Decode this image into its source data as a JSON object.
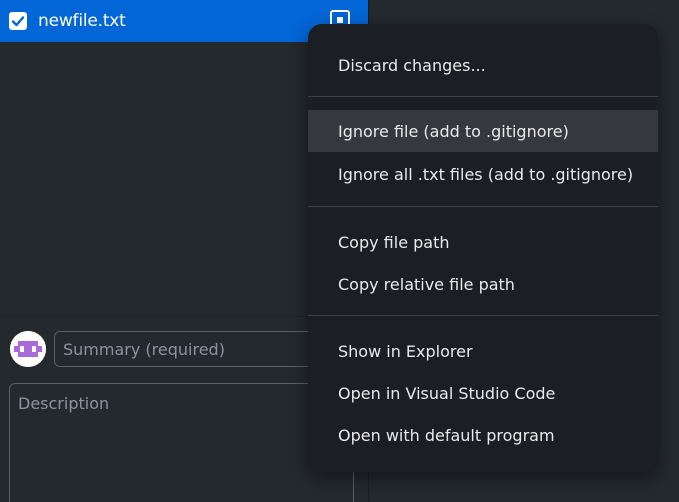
{
  "changes": {
    "file": {
      "name": "newfile.txt",
      "checked": true,
      "status_icon": "file-added-icon"
    }
  },
  "commit": {
    "summary_placeholder": "Summary (required)",
    "description_placeholder": "Description"
  },
  "context_menu": {
    "groups": [
      {
        "items": [
          {
            "label": "Discard changes..."
          }
        ]
      },
      {
        "items": [
          {
            "label": "Ignore file (add to .gitignore)",
            "highlighted": true
          },
          {
            "label": "Ignore all .txt files (add to .gitignore)"
          }
        ]
      },
      {
        "items": [
          {
            "label": "Copy file path"
          },
          {
            "label": "Copy relative file path"
          }
        ]
      },
      {
        "items": [
          {
            "label": "Show in Explorer"
          },
          {
            "label": "Open in Visual Studio Code"
          },
          {
            "label": "Open with default program"
          }
        ]
      }
    ]
  },
  "colors": {
    "selection": "#0366d6",
    "menu_background": "#1b1e22",
    "menu_hover": "#35383c",
    "avatar_accent": "#a86ad8"
  }
}
